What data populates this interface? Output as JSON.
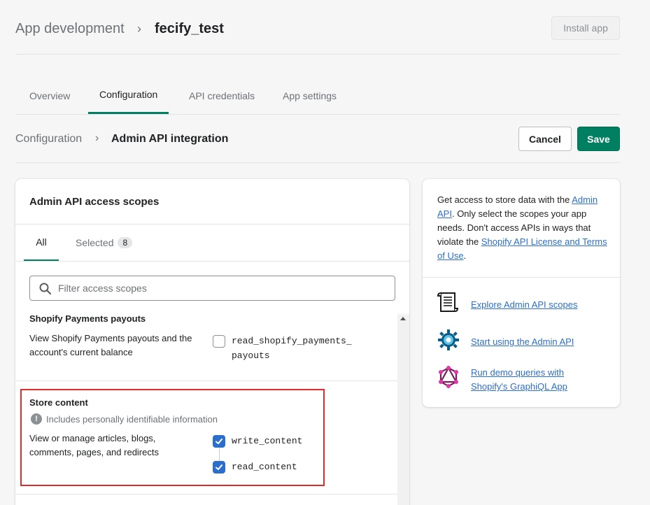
{
  "header": {
    "breadcrumb_parent": "App development",
    "breadcrumb_separator": "›",
    "app_name": "fecify_test",
    "install_label": "Install app"
  },
  "tabs": [
    {
      "label": "Overview"
    },
    {
      "label": "Configuration"
    },
    {
      "label": "API credentials"
    },
    {
      "label": "App settings"
    }
  ],
  "subheader": {
    "parent": "Configuration",
    "current": "Admin API integration",
    "cancel_label": "Cancel",
    "save_label": "Save"
  },
  "scopes_card": {
    "title": "Admin API access scopes",
    "tab_all": "All",
    "tab_selected": "Selected",
    "selected_count": "8",
    "search_placeholder": "Filter access scopes",
    "sections": [
      {
        "title": "Shopify Payments payouts",
        "description": "View Shopify Payments payouts and the account's current balance",
        "scopes": [
          {
            "name_line1": "read_shopify_payments_",
            "name_line2": "payouts",
            "checked": false
          }
        ]
      },
      {
        "title": "Store content",
        "warning": "Includes personally identifiable information",
        "description": "View or manage articles, blogs, comments, pages, and redirects",
        "scopes": [
          {
            "name": "write_content",
            "checked": true
          },
          {
            "name": "read_content",
            "checked": true
          }
        ]
      }
    ]
  },
  "side_card": {
    "intro_1": "Get access to store data with the ",
    "intro_link_1": "Admin API",
    "intro_2": ". Only select the scopes your app needs. Don't access APIs in ways that violate the ",
    "intro_link_2": "Shopify API License and Terms of Use",
    "intro_3": ".",
    "resources": [
      {
        "label": "Explore Admin API scopes",
        "icon": "scroll-document-icon"
      },
      {
        "label": "Start using the Admin API",
        "icon": "gear-icon"
      },
      {
        "label_line1": "Run demo queries with",
        "label_line2": "Shopify's GraphiQL App",
        "icon": "graphql-icon"
      }
    ]
  },
  "colors": {
    "primary": "#008060",
    "link": "#2c6ecb",
    "highlight_border": "#e02b2b",
    "checkbox_checked": "#2c6ecb"
  }
}
